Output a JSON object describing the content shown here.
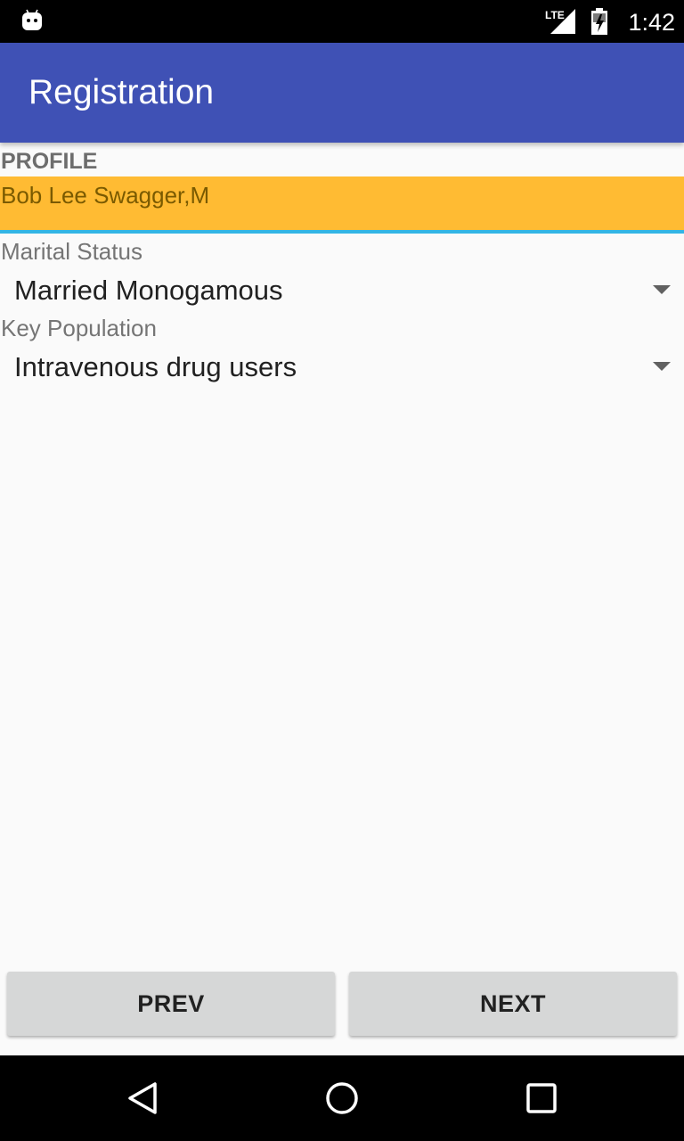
{
  "status_bar": {
    "time": "1:42",
    "network": "LTE",
    "icons": [
      "android-notification-icon",
      "lte-signal-icon",
      "battery-icon"
    ]
  },
  "app_bar": {
    "title": "Registration",
    "color": "#3f51b5"
  },
  "profile": {
    "section_header": "PROFILE",
    "name": "Bob Lee Swagger,M",
    "highlight_color": "#ffbb33",
    "underline_color": "#33b5e5"
  },
  "fields": [
    {
      "label": "Marital Status",
      "value": "Married Monogamous"
    },
    {
      "label": "Key Population",
      "value": "Intravenous drug users"
    }
  ],
  "buttons": {
    "prev_label": "PREV",
    "next_label": "NEXT"
  },
  "nav_bar": {
    "icons": [
      "back-icon",
      "home-icon",
      "recents-icon"
    ]
  }
}
